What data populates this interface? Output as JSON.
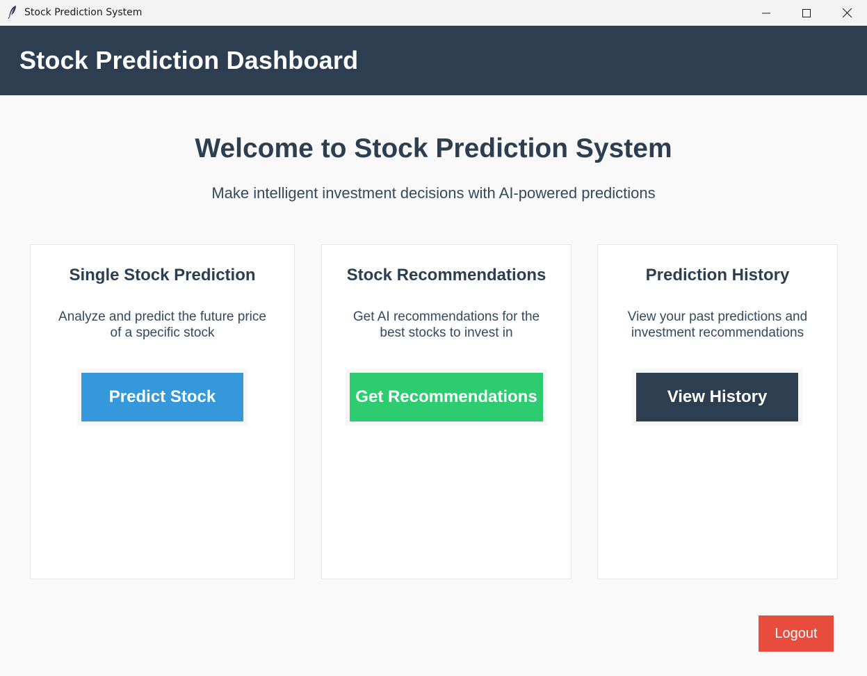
{
  "window": {
    "title": "Stock Prediction System",
    "app_icon": "feather-icon"
  },
  "header": {
    "title": "Stock Prediction Dashboard",
    "bg_color": "#2c3e50"
  },
  "welcome": {
    "title": "Welcome to Stock Prediction System",
    "tagline": "Make intelligent investment decisions with AI-powered predictions"
  },
  "cards": [
    {
      "title": "Single Stock Prediction",
      "description": "Analyze and predict the future price of a specific stock",
      "button_label": "Predict Stock",
      "button_color": "#3498db"
    },
    {
      "title": "Stock Recommendations",
      "description": "Get AI recommendations for the best stocks to invest in",
      "button_label": "Get Recommendations",
      "button_color": "#2ecc71"
    },
    {
      "title": "Prediction History",
      "description": "View your past predictions and investment recommendations",
      "button_label": "View History",
      "button_color": "#2c3e50"
    }
  ],
  "logout": {
    "label": "Logout",
    "color": "#e74c3c"
  }
}
